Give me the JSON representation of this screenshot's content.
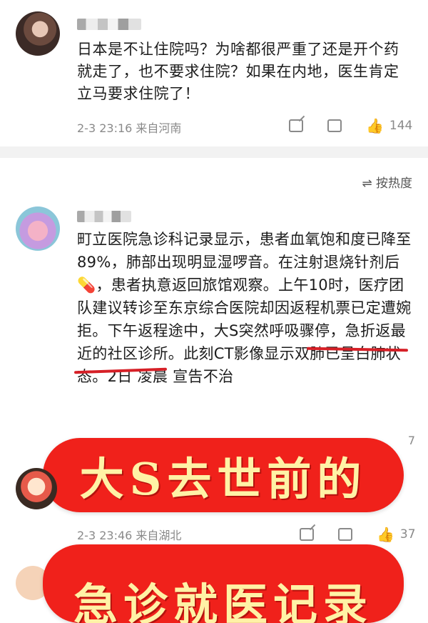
{
  "comment1": {
    "text": "日本是不让住院吗？为啥都很严重了还是开个药就走了，也不要求住院？如果在内地，医生肯定立马要求住院了！",
    "time": "2-3 23:16",
    "location": "来自河南",
    "likes": "144"
  },
  "sort": {
    "label": "按热度"
  },
  "comment2": {
    "text": "町立医院急诊科记录显示，患者血氧饱和度已降至89%，肺部出现明显湿啰音。在注射退烧针剂后💊，患者执意返回旅馆观察。上午10时，医疗团队建议转诊至东京综合医院却因返程机票已定遭婉拒。下午返程途中，大S突然呼吸骤停，急折返最近的社区诊所。此刻CT影像显示双肺已呈白肺状态。2日 凌晨 宣告不治",
    "likes_partial": "7"
  },
  "comment3": {
    "time": "2-3 23:46",
    "location": "来自湖北",
    "likes": "37"
  },
  "banners": {
    "line1": "大S去世前的",
    "line2": "急诊就医记录"
  },
  "colors": {
    "accent_red": "#f0211b",
    "banner_text": "#fff2a6",
    "underline": "#d62027"
  }
}
